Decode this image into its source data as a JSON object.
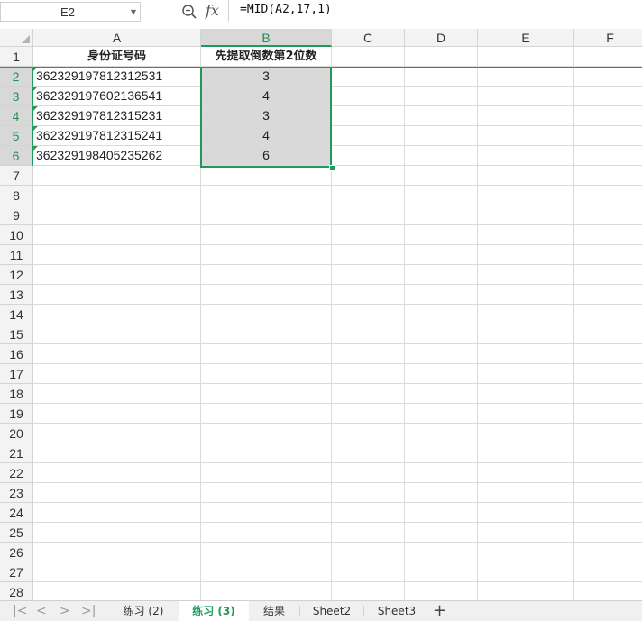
{
  "formula_bar": {
    "name_box": "E2",
    "fx_label": "fx",
    "formula": "=MID(A2,17,1)"
  },
  "columns": [
    "A",
    "B",
    "C",
    "D",
    "E",
    "F"
  ],
  "rows": [
    "1",
    "2",
    "3",
    "4",
    "5",
    "6",
    "7",
    "8",
    "9",
    "10",
    "11",
    "12",
    "13",
    "14",
    "15",
    "16",
    "17",
    "18",
    "19",
    "20",
    "21",
    "22",
    "23",
    "24",
    "25",
    "26",
    "27",
    "28"
  ],
  "cells": {
    "A1": "身份证号码",
    "B1": "先提取倒数第2位数",
    "A": [
      "362329197812312531",
      "362329197602136541",
      "362329197812315231",
      "362329197812315241",
      "362329198405235262"
    ],
    "B": [
      "3",
      "4",
      "3",
      "4",
      "6"
    ]
  },
  "tabs": [
    "练习 (2)",
    "练习 (3)",
    "结果",
    "Sheet2",
    "Sheet3"
  ],
  "active_tab": "练习 (3)",
  "colors": {
    "accent": "#1e9a5a",
    "selection_fill": "#d9d9d9"
  }
}
